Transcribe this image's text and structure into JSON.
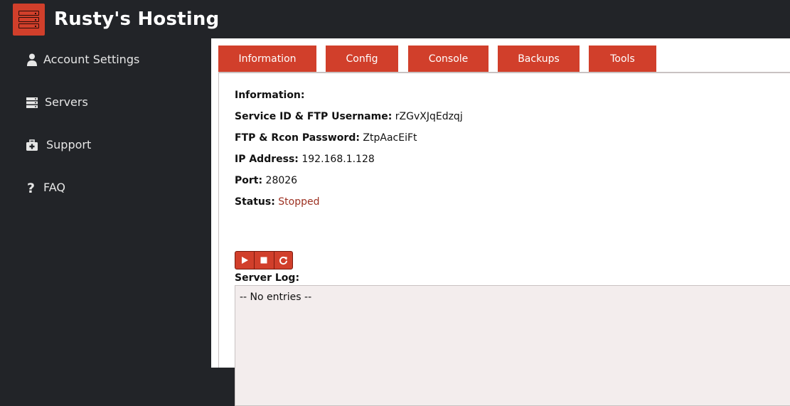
{
  "app": {
    "title": "Rusty's Hosting",
    "logo_icon": "server-stack-icon",
    "brand_color": "#d13f2b"
  },
  "sidebar": {
    "items": [
      {
        "label": "Account Settings",
        "icon": "user-icon"
      },
      {
        "label": "Servers",
        "icon": "servers-icon"
      },
      {
        "label": "Support",
        "icon": "medkit-icon"
      },
      {
        "label": "FAQ",
        "icon": "question-icon"
      }
    ]
  },
  "tabs": [
    {
      "label": "Information"
    },
    {
      "label": "Config"
    },
    {
      "label": "Console"
    },
    {
      "label": "Backups"
    },
    {
      "label": "Tools"
    }
  ],
  "info": {
    "heading": "Information:",
    "service_id_label": "Service ID & FTP Username:",
    "service_id_value": "rZGvXJqEdzqj",
    "password_label": "FTP & Rcon Password:",
    "password_value": "ZtpAacEiFt",
    "ip_label": "IP Address:",
    "ip_value": "192.168.1.128",
    "port_label": "Port:",
    "port_value": "28026",
    "status_label": "Status:",
    "status_value": "Stopped",
    "status_color": "#9c3021"
  },
  "controls": {
    "start_icon": "play-icon",
    "stop_icon": "stop-icon",
    "restart_icon": "restart-icon"
  },
  "log": {
    "label": "Server Log:",
    "content": "-- No entries --"
  }
}
